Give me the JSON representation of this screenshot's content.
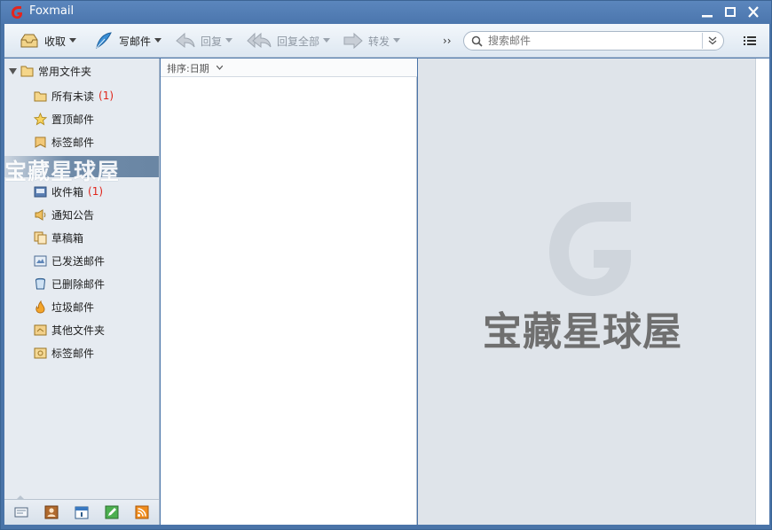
{
  "window": {
    "title": "Foxmail"
  },
  "toolbar": {
    "receive": "收取",
    "compose": "写邮件",
    "reply": "回复",
    "reply_all": "回复全部",
    "forward": "转发",
    "more": "››",
    "search_placeholder": "搜索邮件"
  },
  "sidebar": {
    "root_label": "常用文件夹",
    "quick_items": [
      {
        "label": "所有未读",
        "count": "(1)",
        "icon": "folder-icon"
      },
      {
        "label": "置顶邮件",
        "count": "",
        "icon": "star-icon"
      },
      {
        "label": "标签邮件",
        "count": "",
        "icon": "tag-icon"
      }
    ],
    "account_label": "宝藏星球屋",
    "folders": [
      {
        "label": "收件箱",
        "count": "(1)",
        "icon": "inbox-icon"
      },
      {
        "label": "通知公告",
        "count": "",
        "icon": "speaker-icon"
      },
      {
        "label": "草稿箱",
        "count": "",
        "icon": "draft-icon"
      },
      {
        "label": "已发送邮件",
        "count": "",
        "icon": "sent-icon"
      },
      {
        "label": "已删除邮件",
        "count": "",
        "icon": "trash-icon"
      },
      {
        "label": "垃圾邮件",
        "count": "",
        "icon": "spam-icon"
      },
      {
        "label": "其他文件夹",
        "count": "",
        "icon": "other-folder-icon"
      },
      {
        "label": "标签邮件",
        "count": "",
        "icon": "label-icon"
      }
    ]
  },
  "maillist": {
    "sort_label": "排序:日期"
  },
  "preview": {
    "watermark": "宝藏星球屋"
  },
  "colors": {
    "accent": "#4b76ad",
    "unread": "#e0251b",
    "selection": "#6e8aa8"
  }
}
